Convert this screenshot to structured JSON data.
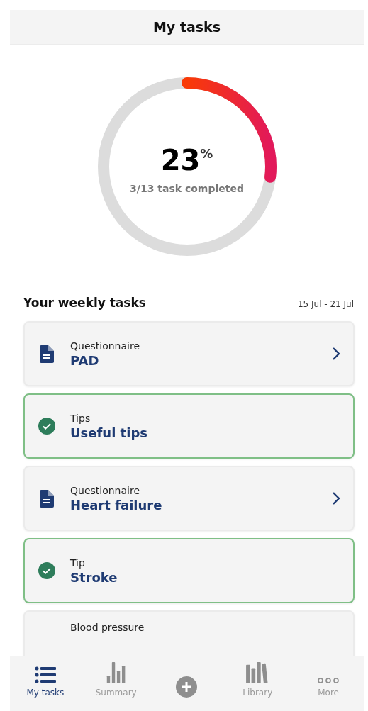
{
  "header": {
    "title": "My tasks"
  },
  "progress": {
    "percent": "23",
    "unit": "%",
    "caption": "3/13 task completed"
  },
  "weekly": {
    "title": "Your weekly tasks",
    "date_range": "15 Jul - 21 Jul"
  },
  "tasks": [
    {
      "kind": "questionnaire",
      "category": "Questionnaire",
      "title": "PAD",
      "done": false
    },
    {
      "kind": "tip",
      "category": "Tips",
      "title": "Useful tips",
      "done": true
    },
    {
      "kind": "questionnaire",
      "category": "Questionnaire",
      "title": "Heart failure",
      "done": false
    },
    {
      "kind": "tip",
      "category": "Tip",
      "title": "Stroke",
      "done": true
    },
    {
      "category": "Blood pressure",
      "done": false
    }
  ],
  "tab_bar": [
    {
      "kind": "list",
      "label": "My tasks",
      "selected": true
    },
    {
      "kind": "chart",
      "label": "Summary",
      "selected": false
    },
    {
      "kind": "add",
      "selected": false
    },
    {
      "kind": "library",
      "label": "Library",
      "selected": false
    },
    {
      "kind": "more",
      "label": "More",
      "selected": false
    }
  ]
}
